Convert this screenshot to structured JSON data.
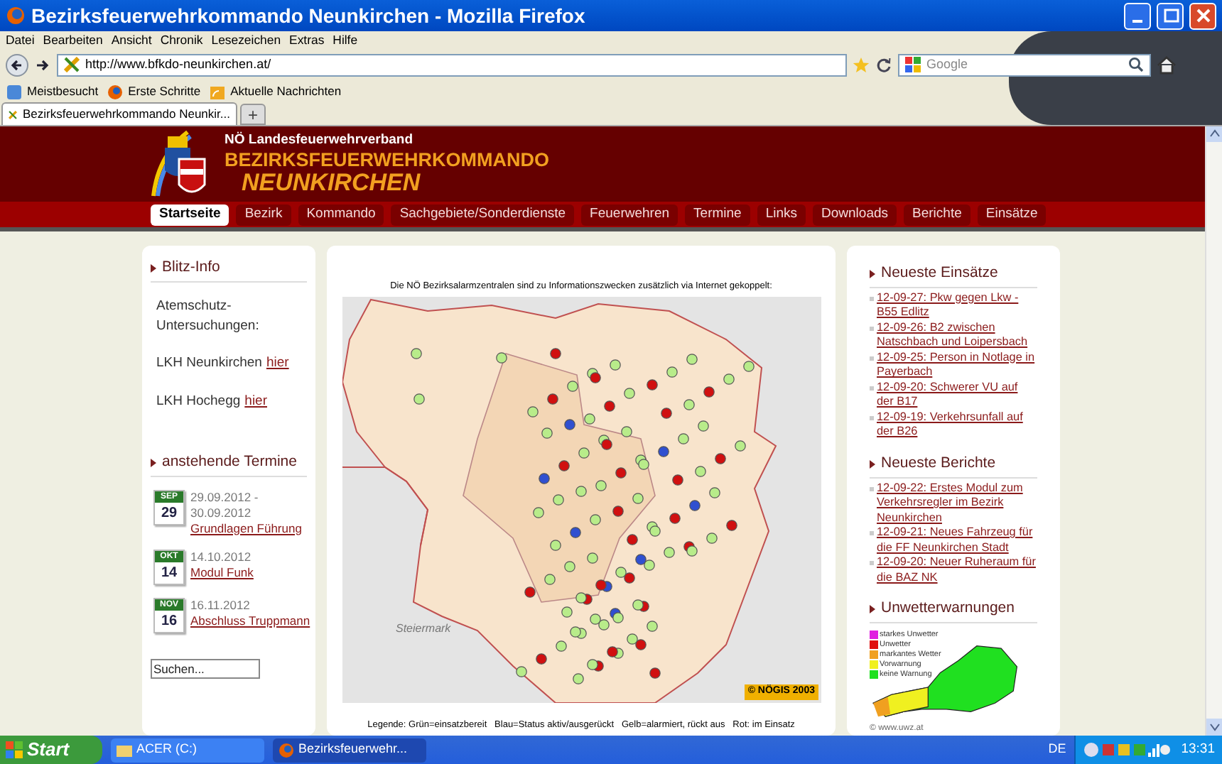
{
  "window": {
    "title": "Bezirksfeuerwehrkommando Neunkirchen - Mozilla Firefox"
  },
  "menu": [
    "Datei",
    "Bearbeiten",
    "Ansicht",
    "Chronik",
    "Lesezeichen",
    "Extras",
    "Hilfe"
  ],
  "url": "http://www.bfkdo-neunkirchen.at/",
  "search": {
    "placeholder": "Google"
  },
  "bookmarks": [
    "Meistbesucht",
    "Erste Schritte",
    "Aktuelle Nachrichten"
  ],
  "tabs": [
    {
      "label": "Bezirksfeuerwehrkommando Neunkir...",
      "selected": true
    }
  ],
  "tab_add": "+",
  "site": {
    "org": "NÖ Landesfeuerwehrverband",
    "title": "BEZIRKSFEUERWEHRKOMMANDO",
    "subtitle": "NEUNKIRCHEN"
  },
  "nav": [
    {
      "label": "Startseite",
      "selected": true
    },
    {
      "label": "Bezirk",
      "selected": false
    },
    {
      "label": "Kommando",
      "selected": false
    },
    {
      "label": "Sachgebiete/Sonderdienste",
      "selected": false
    },
    {
      "label": "Feuerwehren",
      "selected": false
    },
    {
      "label": "Termine",
      "selected": false
    },
    {
      "label": "Links",
      "selected": false
    },
    {
      "label": "Downloads",
      "selected": false
    },
    {
      "label": "Berichte",
      "selected": false
    },
    {
      "label": "Einsätze",
      "selected": false
    }
  ],
  "blitz": {
    "heading": "Blitz-Info",
    "intro": "Atemschutz-Untersuchungen:",
    "links": [
      {
        "text": "LKH Neunkirchen",
        "link": "hier"
      },
      {
        "text": "LKH Hochegg",
        "link": "hier"
      }
    ]
  },
  "termine": {
    "heading": "anstehende Termine",
    "events": [
      {
        "month": "SEP",
        "day": "29",
        "date": "29.09.2012 - 30.09.2012",
        "title": "Grundlagen Führung"
      },
      {
        "month": "OKT",
        "day": "14",
        "date": "14.10.2012",
        "title": "Modul Funk"
      },
      {
        "month": "NOV",
        "day": "16",
        "date": "16.11.2012",
        "title": "Abschluss Truppmann"
      }
    ]
  },
  "search_box": {
    "placeholder": "Suchen..."
  },
  "map": {
    "caption": "Die NÖ Bezirksalarmzentralen sind zu Informationszwecken zusätzlich via Internet gekoppelt:",
    "region": "Steiermark",
    "copyright": "© NÖGIS 2003",
    "legend": "Legende: Grün=einsatzbereit   Blau=Status aktiv/ausgerückt   Gelb=alarmiert, rückt aus   Rot: im Einsatz"
  },
  "einsaetze": {
    "heading": "Neueste Einsätze",
    "items": [
      "12-09-27: Pkw gegen Lkw - B55 Edlitz",
      "12-09-26: B2 zwischen Natschbach und Loipersbach",
      "12-09-25: Person in Notlage in Payerbach",
      "12-09-20: Schwerer VU auf der B17",
      "12-09-19: Verkehrsunfall auf der B26"
    ]
  },
  "berichte": {
    "heading": "Neueste Berichte",
    "items": [
      "12-09-22: Erstes Modul zum Verkehrsregler im Bezirk Neunkirchen",
      "12-09-21: Neues Fahrzeug für die FF Neunkirchen Stadt",
      "12-09-20: Neuer Ruheraum für die BAZ NK"
    ]
  },
  "unwetter": {
    "heading": "Unwetterwarnungen",
    "legend": [
      {
        "label": "starkes Unwetter",
        "color": "#e020e0"
      },
      {
        "label": "Unwetter",
        "color": "#e01010"
      },
      {
        "label": "markantes Wetter",
        "color": "#f0a020"
      },
      {
        "label": "Vorwarnung",
        "color": "#f0f020"
      },
      {
        "label": "keine Warnung",
        "color": "#20e020"
      }
    ],
    "copyright": "© www.uwz.at"
  },
  "taskbar": {
    "start": "Start",
    "buttons": [
      {
        "label": "ACER (C:)",
        "selected": false
      },
      {
        "label": "Bezirksfeuerwehr...",
        "selected": true
      }
    ],
    "lang": "DE",
    "clock": "13:31"
  }
}
